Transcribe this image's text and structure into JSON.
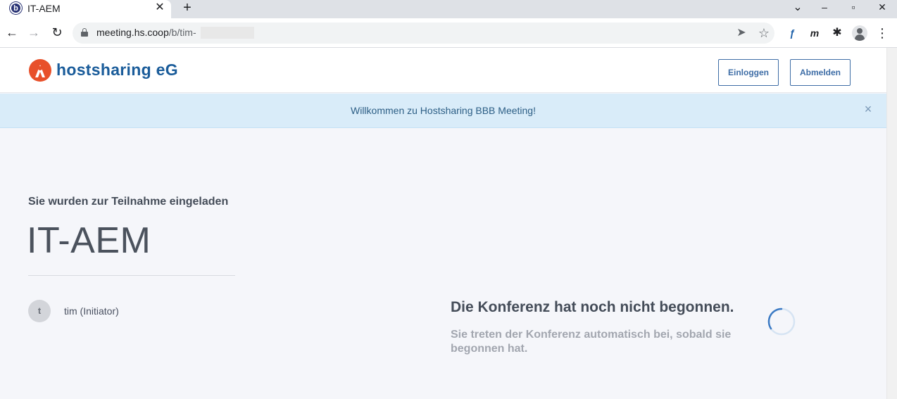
{
  "browser": {
    "tab": {
      "title": "IT-AEM",
      "favicon_letter": "b",
      "close_glyph": "✕"
    },
    "new_tab_glyph": "+",
    "window_controls": {
      "dropdown": "⌄",
      "minimize": "–",
      "maximize": "▫",
      "close": "✕"
    },
    "nav": {
      "back": "←",
      "forward": "→",
      "reload": "↻"
    },
    "url": {
      "host": "meeting.hs.coop",
      "path": "/b/tim-"
    },
    "icons": {
      "send": "➤",
      "star": "☆",
      "ext_f": "ƒ",
      "ext_m": "m",
      "puzzle": "✱",
      "menu": "⋮"
    }
  },
  "header": {
    "brand": "hostsharing eG",
    "login_label": "Einloggen",
    "logout_label": "Abmelden",
    "brand_color": "#e8502a",
    "brand_text_color": "#1a5c9a"
  },
  "alert": {
    "message": "Willkommen zu Hostsharing BBB Meeting!",
    "close_glyph": "×"
  },
  "room": {
    "invite_label": "Sie wurden zur Teilnahme eingeladen",
    "title": "IT-AEM",
    "owner_initial": "t",
    "owner_name": "tim (Initiator)"
  },
  "waiting": {
    "title": "Die Konferenz hat noch nicht begonnen.",
    "subtitle": "Sie treten der Konferenz automatisch bei, sobald sie begonnen hat."
  }
}
